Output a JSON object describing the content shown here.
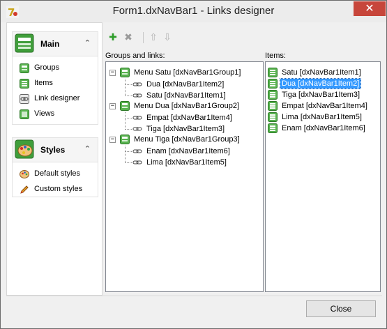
{
  "window": {
    "title": "Form1.dxNavBar1  - Links designer",
    "close_glyph": "✕"
  },
  "navbar": {
    "main_group": {
      "title": "Main",
      "chevron": "⌃",
      "icon": "main-group-icon",
      "items": [
        {
          "label": "Groups",
          "icon": "groups-icon"
        },
        {
          "label": "Items",
          "icon": "items-icon"
        },
        {
          "label": "Link designer",
          "icon": "link-designer-icon"
        },
        {
          "label": "Views",
          "icon": "views-icon"
        }
      ]
    },
    "styles_group": {
      "title": "Styles",
      "chevron": "⌃",
      "icon": "palette-icon",
      "items": [
        {
          "label": "Default styles",
          "icon": "palette-small-icon"
        },
        {
          "label": "Custom styles",
          "icon": "pencil-icon"
        }
      ]
    }
  },
  "toolbar": {
    "add_glyph": "✚",
    "delete_glyph": "✖",
    "up_glyph": "⇧",
    "down_glyph": "⇩"
  },
  "groups_panel": {
    "caption": "Groups and links:",
    "groups": [
      {
        "label": "Menu Satu [dxNavBar1Group1]",
        "expander": "−",
        "links": [
          "Dua [dxNavBar1Item2]",
          "Satu [dxNavBar1Item1]"
        ]
      },
      {
        "label": "Menu Dua [dxNavBar1Group2]",
        "expander": "−",
        "links": [
          "Empat [dxNavBar1Item4]",
          "Tiga [dxNavBar1Item3]"
        ]
      },
      {
        "label": "Menu Tiga [dxNavBar1Group3]",
        "expander": "−",
        "links": [
          "Enam [dxNavBar1Item6]",
          "Lima [dxNavBar1Item5]"
        ]
      }
    ]
  },
  "items_panel": {
    "caption": "Items:",
    "items": [
      {
        "label": "Satu [dxNavBar1Item1]"
      },
      {
        "label": "Dua [dxNavBar1Item2]",
        "selected": true
      },
      {
        "label": "Tiga [dxNavBar1Item3]"
      },
      {
        "label": "Empat [dxNavBar1Item4]"
      },
      {
        "label": "Lima [dxNavBar1Item5]"
      },
      {
        "label": "Enam [dxNavBar1Item6]"
      }
    ]
  },
  "footer": {
    "close_label": "Close"
  },
  "colors": {
    "accent_green": "#2e9d2a",
    "selection_blue": "#3399ff",
    "close_button_red": "#c7463b"
  }
}
